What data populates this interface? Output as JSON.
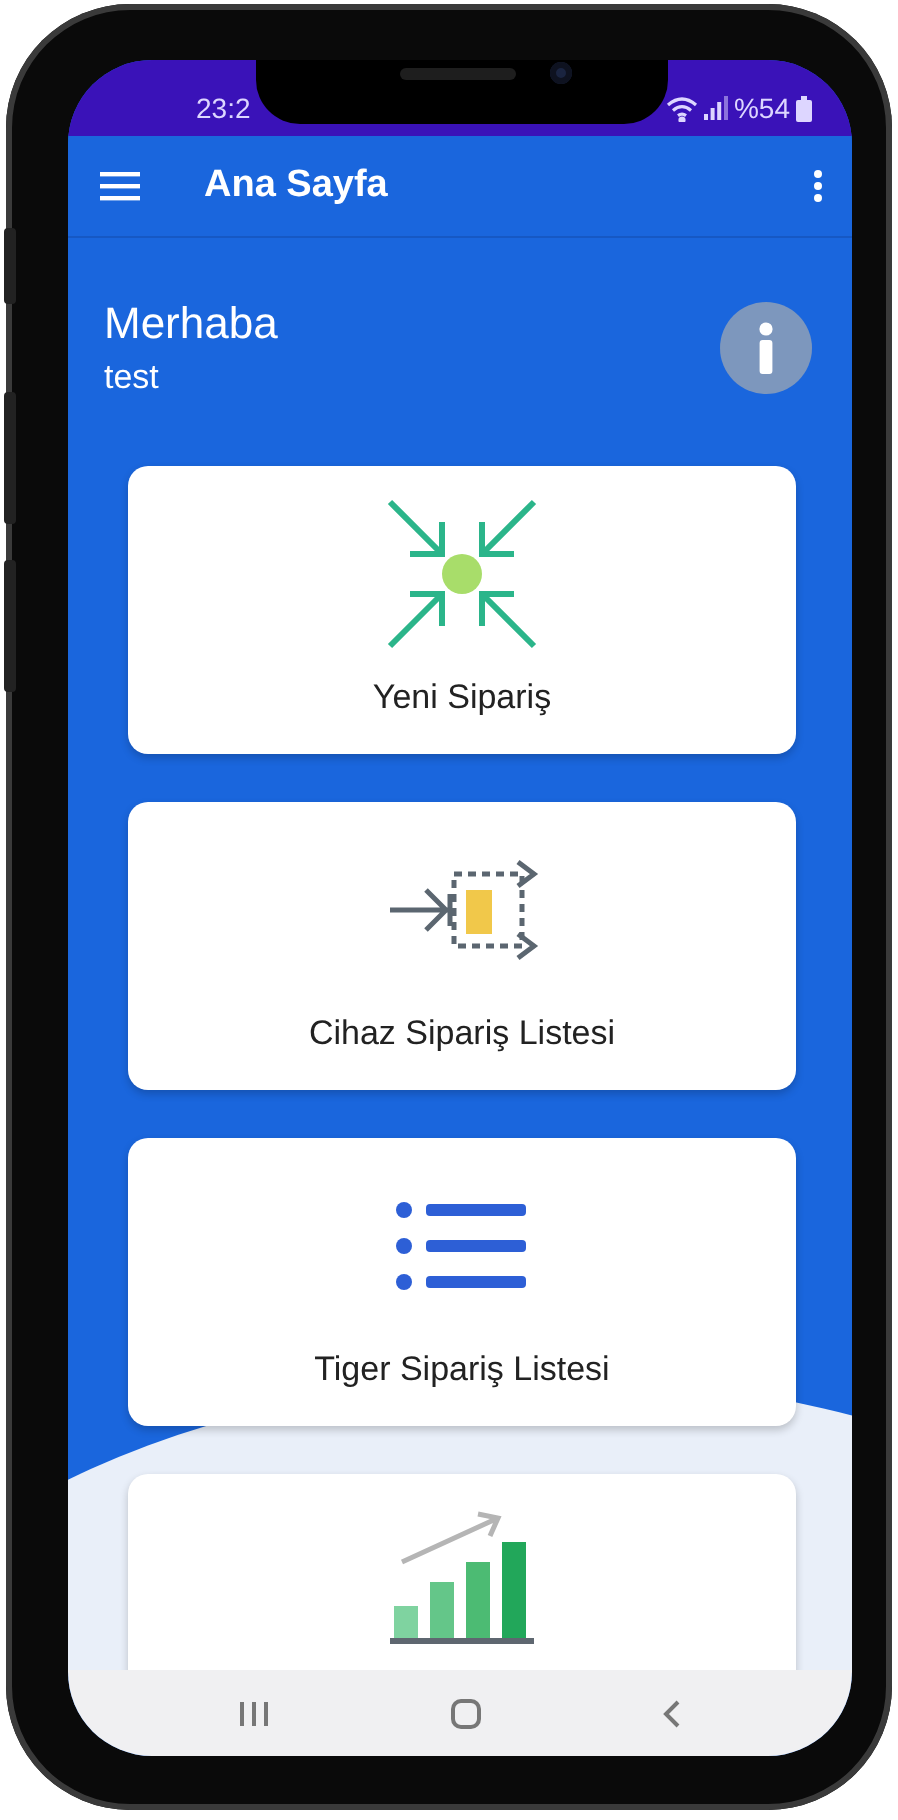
{
  "status_bar": {
    "time": "23:2",
    "battery": "%54"
  },
  "app_bar": {
    "title": "Ana Sayfa"
  },
  "greeting": {
    "title": "Merhaba",
    "user": "test"
  },
  "cards": [
    {
      "kind": "new-order",
      "label": "Yeni Sipariş"
    },
    {
      "kind": "device-list",
      "label": "Cihaz Sipariş Listesi"
    },
    {
      "kind": "list",
      "label": "Tiger Sipariş Listesi"
    },
    {
      "kind": "chart"
    }
  ]
}
